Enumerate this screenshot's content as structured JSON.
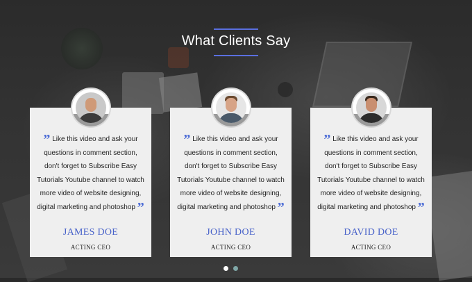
{
  "section": {
    "title": "What Clients Say",
    "accent_color": "#5a6fe0"
  },
  "testimonials": [
    {
      "quote": "Like this video and ask your questions in comment section, don't forget to Subscribe Easy Tutorials Youtube channel to watch more video of website designing, digital marketing and photoshop",
      "name": "JAMES DOE",
      "role": "ACTING CEO",
      "avatar_icon": "bald-bearded-man-avatar"
    },
    {
      "quote": "Like this video and ask your questions in comment section, don't forget to Subscribe Easy Tutorials Youtube channel to watch more video of website designing, digital marketing and photoshop",
      "name": "JOHN DOE",
      "role": "ACTING CEO",
      "avatar_icon": "bearded-man-avatar"
    },
    {
      "quote": "Like this video and ask your questions in comment section, don't forget to Subscribe Easy Tutorials Youtube channel to watch more video of website designing, digital marketing and photoshop",
      "name": "DAVID DOE",
      "role": "ACTING CEO",
      "avatar_icon": "man-with-glasses-avatar"
    }
  ],
  "carousel": {
    "pages": 2,
    "active_page": 1,
    "active_color": "#ffffff",
    "inactive_color": "#7fa7a7"
  },
  "quote_mark_open": "”",
  "quote_mark_close": "”"
}
